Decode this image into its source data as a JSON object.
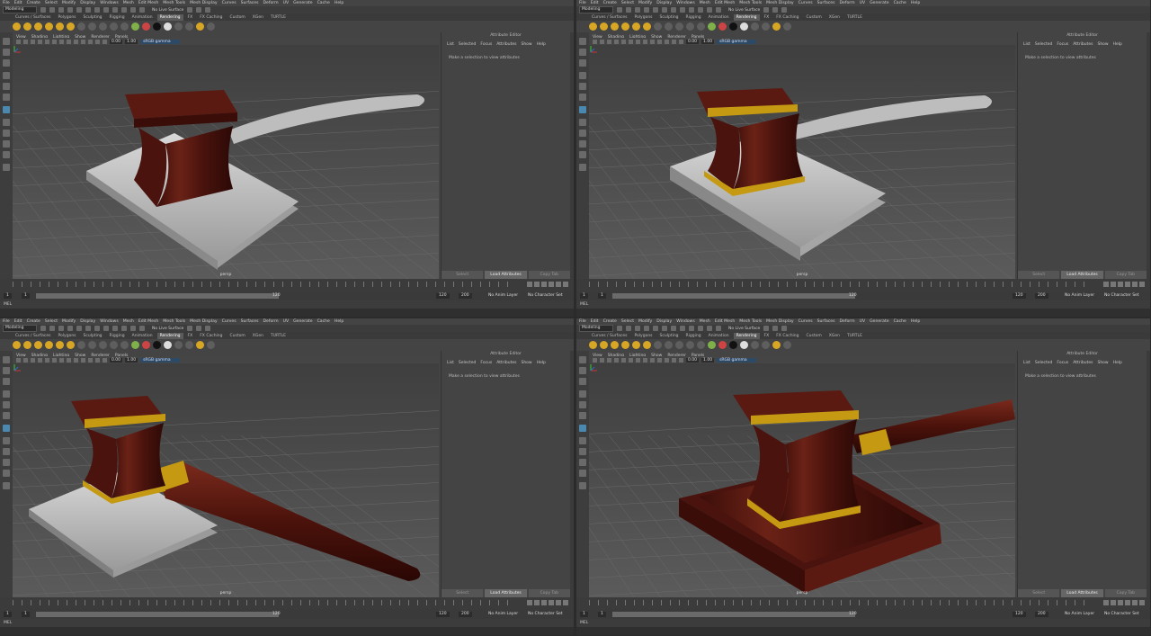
{
  "menu": [
    "File",
    "Edit",
    "Create",
    "Select",
    "Modify",
    "Display",
    "Windows",
    "Mesh",
    "Edit Mesh",
    "Mesh Tools",
    "Mesh Display",
    "Curves",
    "Surfaces",
    "Deform",
    "UV",
    "Generate",
    "Cache",
    "Help"
  ],
  "mode": "Modeling",
  "no_live_surface": "No Live Surface",
  "shelf_tabs": [
    "Curves / Surfaces",
    "Polygons",
    "Sculpting",
    "Rigging",
    "Animation",
    "Rendering",
    "FX",
    "FX Caching",
    "Custom",
    "XGen",
    "TURTLE"
  ],
  "active_shelf": "Rendering",
  "panel_menu": [
    "View",
    "Shading",
    "Lighting",
    "Show",
    "Renderer",
    "Panels"
  ],
  "panel_values": {
    "exposure": "0.00",
    "gamma": "1.00",
    "color_space": "sRGB gamma"
  },
  "camera": "persp",
  "attribute_editor": {
    "title": "Attribute Editor",
    "menu": [
      "List",
      "Selected",
      "Focus",
      "Attributes",
      "Show",
      "Help"
    ],
    "message": "Make a selection to view attributes",
    "buttons": [
      "Select",
      "Load Attributes",
      "Copy Tab"
    ]
  },
  "timeline": {
    "start": "1",
    "current": "1",
    "end": "120",
    "range_end": "120",
    "max": "200",
    "anim_layer": "No Anim Layer",
    "char_set": "No Character Set"
  },
  "command_line": "MEL",
  "colors": {
    "wood": "#5a1a12",
    "gold": "#c59a12",
    "plate": "#b9b9b9",
    "handle": "#bdbdbd"
  }
}
